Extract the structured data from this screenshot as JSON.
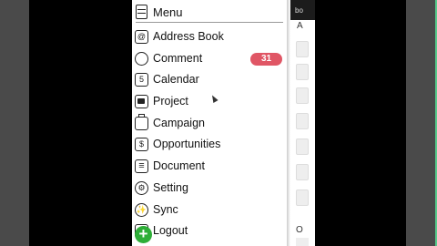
{
  "menu": {
    "title": "Menu",
    "items": [
      {
        "label": "Address Book",
        "icon": "address-book-icon",
        "icon_glyph": "@"
      },
      {
        "label": "Comment",
        "icon": "comment-icon",
        "icon_glyph": "",
        "badge": "31"
      },
      {
        "label": "Calendar",
        "icon": "calendar-icon",
        "icon_glyph": "5"
      },
      {
        "label": "Project",
        "icon": "folder-icon",
        "icon_glyph": ""
      },
      {
        "label": "Campaign",
        "icon": "briefcase-icon",
        "icon_glyph": ""
      },
      {
        "label": "Opportunities",
        "icon": "dollar-document-icon",
        "icon_glyph": "$"
      },
      {
        "label": "Document",
        "icon": "document-icon",
        "icon_glyph": ""
      },
      {
        "label": "Setting",
        "icon": "gear-icon",
        "icon_glyph": "⚙"
      },
      {
        "label": "Sync",
        "icon": "sync-puzzle-icon",
        "icon_glyph": "✨"
      },
      {
        "label": "Logout",
        "icon": "logout-icon",
        "icon_glyph": ""
      }
    ]
  },
  "fab": {
    "glyph": "+",
    "icon": "add-icon",
    "color": "#2eae38"
  },
  "background": {
    "topbar_text": "bo",
    "letter_top": "A",
    "letter_bottom": "O"
  },
  "colors": {
    "badge": "#e05665",
    "fab": "#2eae38",
    "side_bars": "#4a4a4a"
  }
}
